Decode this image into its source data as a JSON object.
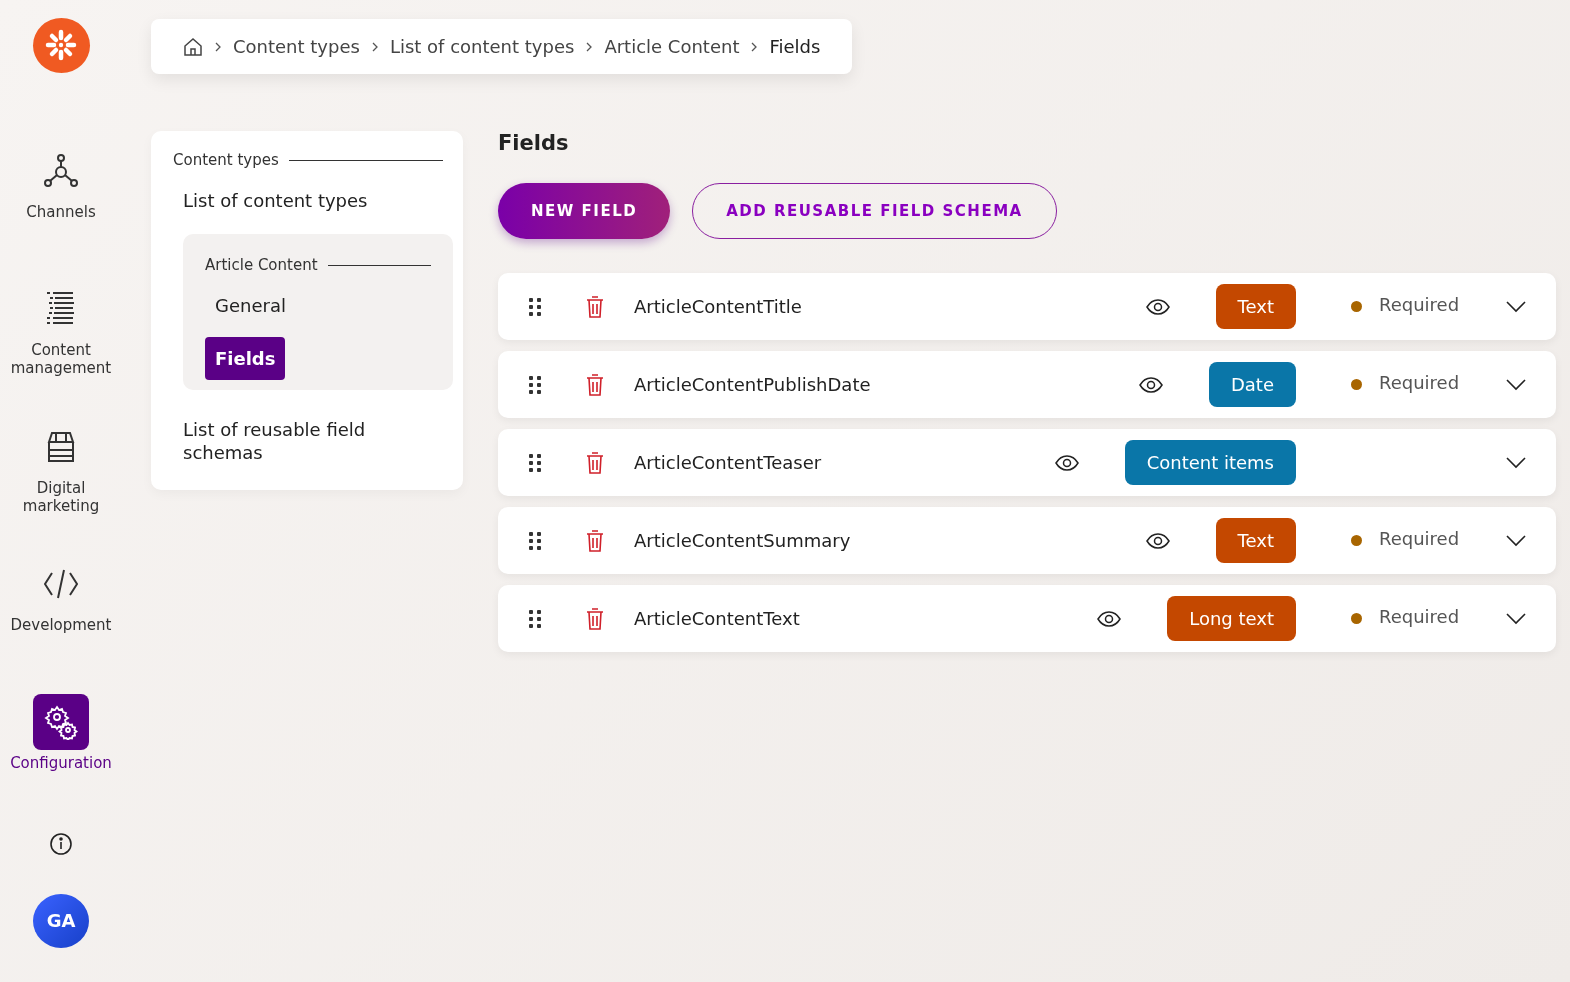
{
  "nav": {
    "items": [
      {
        "label": "Channels",
        "selected": false
      },
      {
        "label": "Content management",
        "selected": false
      },
      {
        "label": "Digital marketing",
        "selected": false
      },
      {
        "label": "Development",
        "selected": false
      },
      {
        "label": "Configuration",
        "selected": true
      }
    ],
    "avatar": "GA"
  },
  "breadcrumb": [
    "Content types",
    "List of content types",
    "Article Content",
    "Fields"
  ],
  "panel": {
    "heading": "Content types",
    "items": [
      {
        "label": "List of content types",
        "selected": false
      },
      {
        "group": "Article Content",
        "children": [
          {
            "label": "General",
            "selected": false
          },
          {
            "label": "Fields",
            "selected": true
          }
        ]
      },
      {
        "label": "List of reusable field schemas",
        "selected": false
      }
    ]
  },
  "main": {
    "title": "Fields",
    "buttons": [
      {
        "label": "NEW FIELD",
        "kind": "primary"
      },
      {
        "label": "ADD REUSABLE FIELD SCHEMA",
        "kind": "outline"
      }
    ],
    "fields": [
      {
        "name": "ArticleContentTitle",
        "type": "Text",
        "color": "#c44800",
        "status": "Required"
      },
      {
        "name": "ArticleContentPublishDate",
        "type": "Date",
        "color": "#0a76a8",
        "status": "Required"
      },
      {
        "name": "ArticleContentTeaser",
        "type": "Content items",
        "color": "#0a76a8"
      },
      {
        "name": "ArticleContentSummary",
        "type": "Text",
        "color": "#c44800",
        "status": "Required"
      },
      {
        "name": "ArticleContentText",
        "type": "Long text",
        "color": "#c44800",
        "status": "Required"
      }
    ]
  }
}
